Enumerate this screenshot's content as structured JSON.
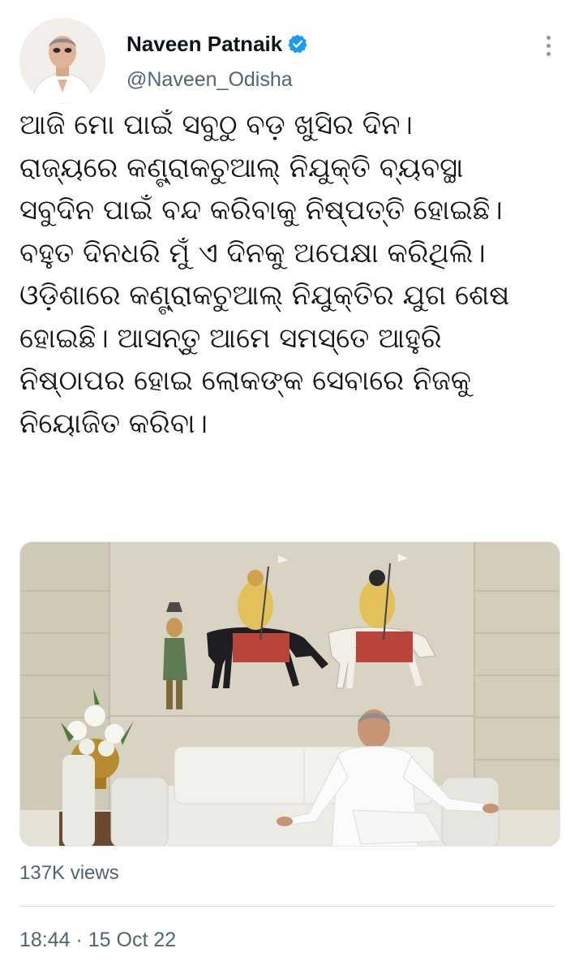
{
  "author": {
    "name": "Naveen Patnaik",
    "handle": "@Naveen_Odisha",
    "verified": true,
    "avatar_icon": "profile-photo-icon",
    "verified_icon": "verified-badge-icon"
  },
  "more_icon": "more-options-icon",
  "tweet": {
    "lines": [
      "ଆଜି ମୋ ପାଇଁ ସବୁଠୁ ବଡ଼ ଖୁସିର ଦିନ।",
      "ରାଜ୍ୟରେ କଣ୍ଟ୍ରାକଚୁଆଲ୍ ନିଯୁକ୍ତି ବ୍ୟବସ୍ଥା",
      "ସବୁଦିନ ପାଇଁ ବନ୍ଦ କରିବାକୁ ନିଷ୍ପତ୍ତି ହୋଇଛି।",
      "ବହୁତ ଦିନଧରି ମୁଁ ଏ ଦିନକୁ ଅପେକ୍ଷା କରିଥିଲି।",
      "ଓଡ଼ିଶାରେ କଣ୍ଟ୍ରାକଚୁଆଲ୍ ନିଯୁକ୍ତିର ଯୁଗ ଶେଷ",
      "ହୋଇଛି। ଆସନ୍ତୁ ଆମେ ସମସ୍ତେ ଆହୁରି",
      "ନିଷ୍ଠାପର ହୋଇ ଲୋକଙ୍କ ସେବାରେ ନିଜକୁ",
      "ନିୟୋଜିତ କରିବା।"
    ]
  },
  "media": {
    "icon": "tweet-photo-icon"
  },
  "stats": {
    "views": "137K views"
  },
  "timestamp": "18:44 · 15 Oct 22",
  "colors": {
    "text": "#0f1419",
    "secondary": "#536471",
    "verified_blue": "#1d9bf0",
    "divider": "#cfd9de"
  }
}
